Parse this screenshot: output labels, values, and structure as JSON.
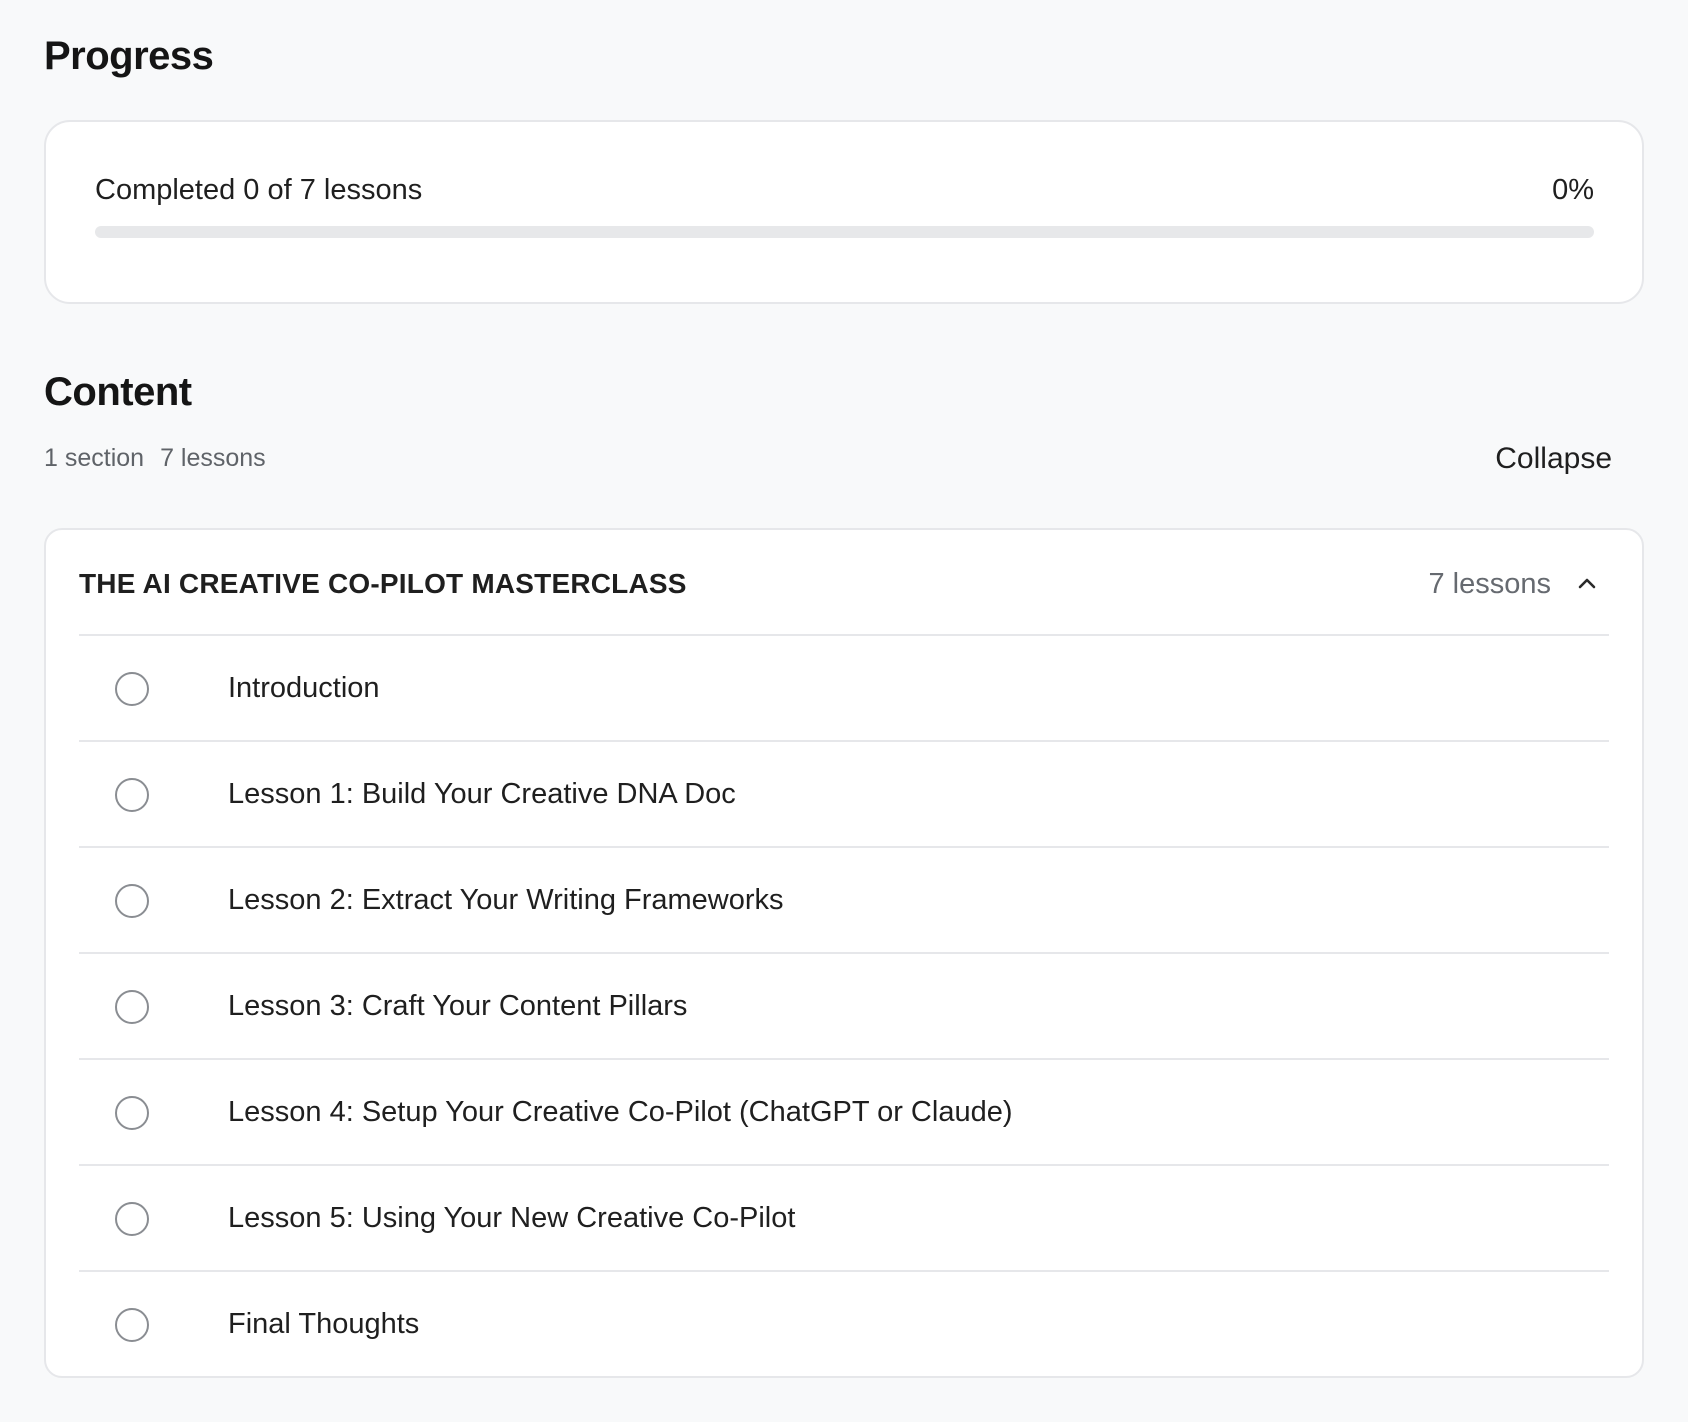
{
  "progress": {
    "heading": "Progress",
    "completed_text": "Completed 0 of 7 lessons",
    "percent_text": "0%",
    "percent_value": 0
  },
  "content": {
    "heading": "Content",
    "section_count": "1 section",
    "lesson_count": "7 lessons",
    "collapse_label": "Collapse"
  },
  "section": {
    "title": "THE AI CREATIVE CO-PILOT MASTERCLASS",
    "count": "7 lessons",
    "expanded_icon": "chevron-up-icon",
    "lessons": [
      {
        "title": "Introduction",
        "completed": false
      },
      {
        "title": "Lesson 1: Build Your Creative DNA Doc",
        "completed": false
      },
      {
        "title": "Lesson 2: Extract Your Writing Frameworks",
        "completed": false
      },
      {
        "title": "Lesson 3: Craft Your Content Pillars",
        "completed": false
      },
      {
        "title": "Lesson 4: Setup Your Creative Co-Pilot (ChatGPT or Claude)",
        "completed": false
      },
      {
        "title": "Lesson 5: Using Your New Creative Co-Pilot",
        "completed": false
      },
      {
        "title": "Final Thoughts",
        "completed": false
      }
    ]
  },
  "colors": {
    "background": "#f8f9fa",
    "card": "#ffffff",
    "border": "#e6e7ea",
    "track": "#e7e8ea",
    "muted_text": "#666a70"
  }
}
